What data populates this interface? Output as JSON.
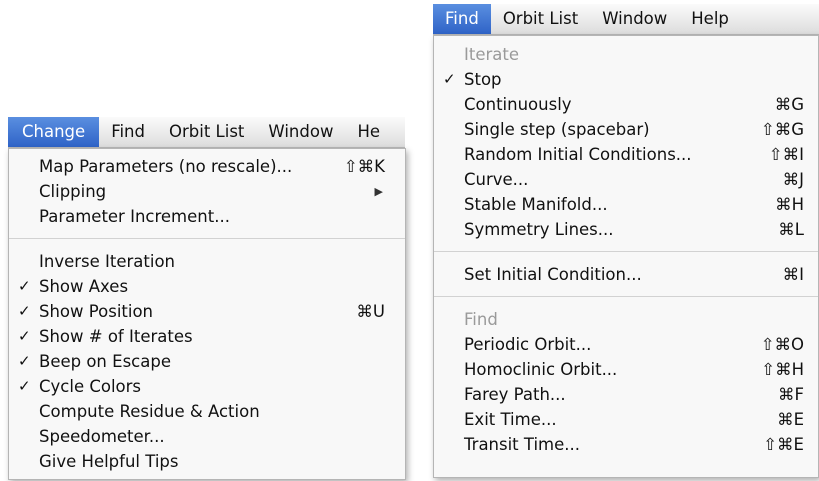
{
  "left": {
    "menubar": [
      "Change",
      "Find",
      "Orbit List",
      "Window",
      "He"
    ],
    "section1": [
      {
        "label": "Map Parameters (no rescale)...",
        "shortcut": "⇧⌘K"
      },
      {
        "label": "Clipping",
        "submenu_arrow": "▶"
      },
      {
        "label": "Parameter Increment..."
      }
    ],
    "section2": [
      {
        "label": "Inverse Iteration",
        "check": ""
      },
      {
        "label": "Show Axes",
        "check": "✓"
      },
      {
        "label": "Show Position",
        "check": "✓",
        "shortcut": "⌘U"
      },
      {
        "label": "Show # of Iterates",
        "check": "✓"
      },
      {
        "label": "Beep on Escape",
        "check": "✓"
      },
      {
        "label": "Cycle Colors",
        "check": "✓"
      },
      {
        "label": "Compute Residue & Action",
        "check": ""
      },
      {
        "label": "Speedometer...",
        "check": ""
      },
      {
        "label": "Give Helpful Tips",
        "check": ""
      }
    ]
  },
  "right": {
    "menubar": [
      "Find",
      "Orbit List",
      "Window",
      "Help"
    ],
    "iterate_header": "Iterate",
    "iterate_items": [
      {
        "label": "Stop",
        "check": "✓"
      },
      {
        "label": "Continuously",
        "shortcut": "⌘G"
      },
      {
        "label": "Single step (spacebar)",
        "shortcut": "⇧⌘G"
      },
      {
        "label": "Random Initial Conditions...",
        "shortcut": "⇧⌘I"
      },
      {
        "label": "Curve...",
        "shortcut": "⌘J"
      },
      {
        "label": "Stable Manifold...",
        "shortcut": "⌘H"
      },
      {
        "label": "Symmetry Lines...",
        "shortcut": "⌘L"
      }
    ],
    "initial_item": {
      "label": "Set Initial Condition...",
      "shortcut": "⌘I"
    },
    "find_header": "Find",
    "find_items": [
      {
        "label": "Periodic Orbit...",
        "shortcut": "⇧⌘O"
      },
      {
        "label": "Homoclinic Orbit...",
        "shortcut": "⇧⌘H"
      },
      {
        "label": "Farey Path...",
        "shortcut": "⌘F"
      },
      {
        "label": "Exit Time...",
        "shortcut": "⌘E"
      },
      {
        "label": "Transit Time...",
        "shortcut": "⇧⌘E"
      }
    ]
  },
  "colors": {
    "highlight": "#3a6fd0",
    "menu_bg": "#f8f8f8",
    "disabled_text": "#9a9a9a"
  }
}
